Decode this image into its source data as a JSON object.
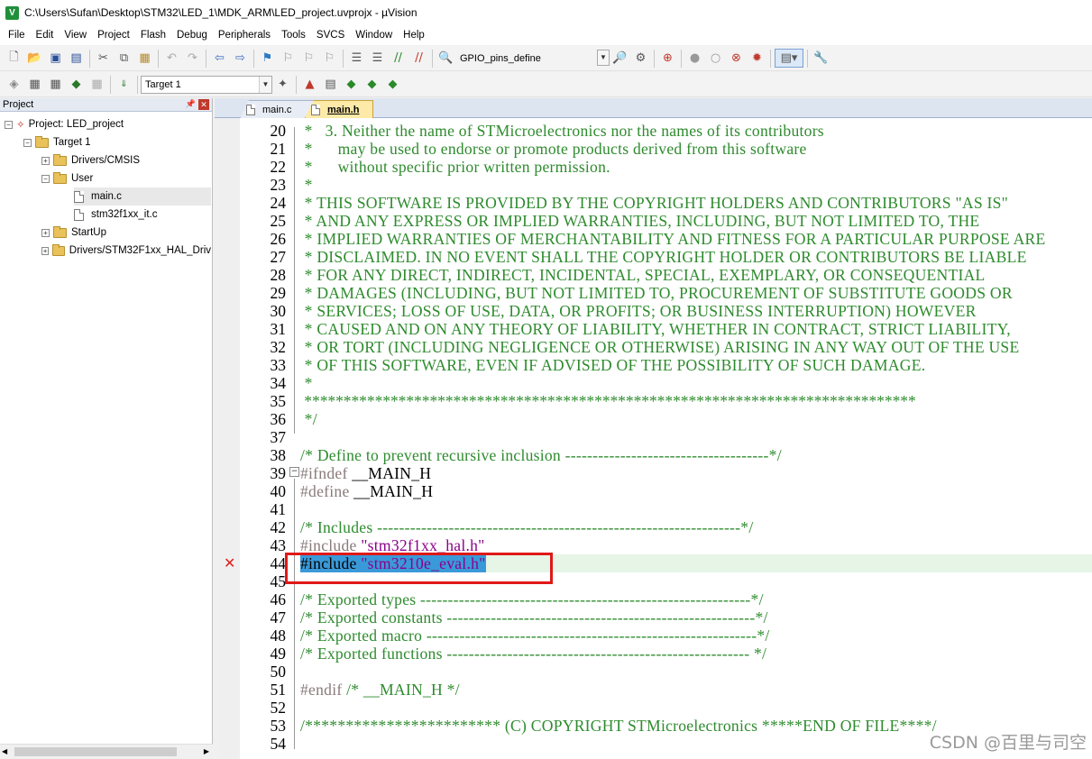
{
  "window": {
    "title": "C:\\Users\\Sufan\\Desktop\\STM32\\LED_1\\MDK_ARM\\LED_project.uvprojx - µVision",
    "logo": "V"
  },
  "menu": [
    "File",
    "Edit",
    "View",
    "Project",
    "Flash",
    "Debug",
    "Peripherals",
    "Tools",
    "SVCS",
    "Window",
    "Help"
  ],
  "toolbar1": {
    "combo_value": "GPIO_pins_define"
  },
  "toolbar2": {
    "target_value": "Target 1"
  },
  "project_panel": {
    "title": "Project",
    "tree": [
      {
        "label": "Project: LED_project",
        "level": 0
      },
      {
        "label": "Target 1",
        "level": 1
      },
      {
        "label": "Drivers/CMSIS",
        "level": 2
      },
      {
        "label": "User",
        "level": 2
      },
      {
        "label": "main.c",
        "level": 3
      },
      {
        "label": "stm32f1xx_it.c",
        "level": 3
      },
      {
        "label": "StartUp",
        "level": 2
      },
      {
        "label": "Drivers/STM32F1xx_HAL_Driv",
        "level": 2
      }
    ]
  },
  "tabs": [
    {
      "label": "main.c",
      "active": false
    },
    {
      "label": "main.h",
      "active": true
    }
  ],
  "code": [
    {
      "n": "20",
      "t": " *   3. Neither the name of STMicroelectronics nor the names of its contributors"
    },
    {
      "n": "21",
      "t": " *      may be used to endorse or promote products derived from this software"
    },
    {
      "n": "22",
      "t": " *      without specific prior written permission."
    },
    {
      "n": "23",
      "t": " *"
    },
    {
      "n": "24",
      "t": " * THIS SOFTWARE IS PROVIDED BY THE COPYRIGHT HOLDERS AND CONTRIBUTORS \"AS IS\""
    },
    {
      "n": "25",
      "t": " * AND ANY EXPRESS OR IMPLIED WARRANTIES, INCLUDING, BUT NOT LIMITED TO, THE"
    },
    {
      "n": "26",
      "t": " * IMPLIED WARRANTIES OF MERCHANTABILITY AND FITNESS FOR A PARTICULAR PURPOSE ARE"
    },
    {
      "n": "27",
      "t": " * DISCLAIMED. IN NO EVENT SHALL THE COPYRIGHT HOLDER OR CONTRIBUTORS BE LIABLE"
    },
    {
      "n": "28",
      "t": " * FOR ANY DIRECT, INDIRECT, INCIDENTAL, SPECIAL, EXEMPLARY, OR CONSEQUENTIAL"
    },
    {
      "n": "29",
      "t": " * DAMAGES (INCLUDING, BUT NOT LIMITED TO, PROCUREMENT OF SUBSTITUTE GOODS OR"
    },
    {
      "n": "30",
      "t": " * SERVICES; LOSS OF USE, DATA, OR PROFITS; OR BUSINESS INTERRUPTION) HOWEVER"
    },
    {
      "n": "31",
      "t": " * CAUSED AND ON ANY THEORY OF LIABILITY, WHETHER IN CONTRACT, STRICT LIABILITY,"
    },
    {
      "n": "32",
      "t": " * OR TORT (INCLUDING NEGLIGENCE OR OTHERWISE) ARISING IN ANY WAY OUT OF THE USE"
    },
    {
      "n": "33",
      "t": " * OF THIS SOFTWARE, EVEN IF ADVISED OF THE POSSIBILITY OF SUCH DAMAGE."
    },
    {
      "n": "34",
      "t": " *"
    },
    {
      "n": "35",
      "t": " ******************************************************************************"
    },
    {
      "n": "36",
      "t": " */"
    },
    {
      "n": "37",
      "t": ""
    },
    {
      "n": "38",
      "t": "/* Define to prevent recursive inclusion -------------------------------------*/"
    },
    {
      "n": "39",
      "t": "#ifndef __MAIN_H"
    },
    {
      "n": "40",
      "t": "#define __MAIN_H"
    },
    {
      "n": "41",
      "t": ""
    },
    {
      "n": "42",
      "t": "/* Includes ------------------------------------------------------------------*/"
    },
    {
      "n": "43",
      "t": "#include \"stm32f1xx_hal.h\""
    },
    {
      "n": "44",
      "t": "#include \"stm3210e_eval.h\""
    },
    {
      "n": "45",
      "t": ""
    },
    {
      "n": "46",
      "t": "/* Exported types ------------------------------------------------------------*/"
    },
    {
      "n": "47",
      "t": "/* Exported constants --------------------------------------------------------*/"
    },
    {
      "n": "48",
      "t": "/* Exported macro ------------------------------------------------------------*/"
    },
    {
      "n": "49",
      "t": "/* Exported functions ------------------------------------------------------- */"
    },
    {
      "n": "50",
      "t": ""
    },
    {
      "n": "51",
      "t": "#endif /* __MAIN_H */"
    },
    {
      "n": "52",
      "t": ""
    },
    {
      "n": "53",
      "t": "/************************ (C) COPYRIGHT STMicroelectronics *****END OF FILE****/"
    },
    {
      "n": "54",
      "t": ""
    }
  ],
  "code_parts": {
    "l39_kw": "#ifndef",
    "l39_rest": " __MAIN_H",
    "l40_kw": "#define",
    "l40_rest": " __MAIN_H",
    "l43_kw": "#include",
    "l43_str": " \"stm32f1xx_hal.h\"",
    "l44_kw": "#include",
    "l44_str": " \"stm3210e_eval.h\"",
    "l51_kw": "#endif",
    "l51_cm": " /* __MAIN_H */"
  },
  "error_marker": "✕",
  "watermark": "CSDN @百里与司空",
  "colors": {
    "comment": "#2e8b2e",
    "string": "#8b008b",
    "preproc": "#8a7a7a",
    "error": "#e02020",
    "selection": "#3a9ad9"
  }
}
